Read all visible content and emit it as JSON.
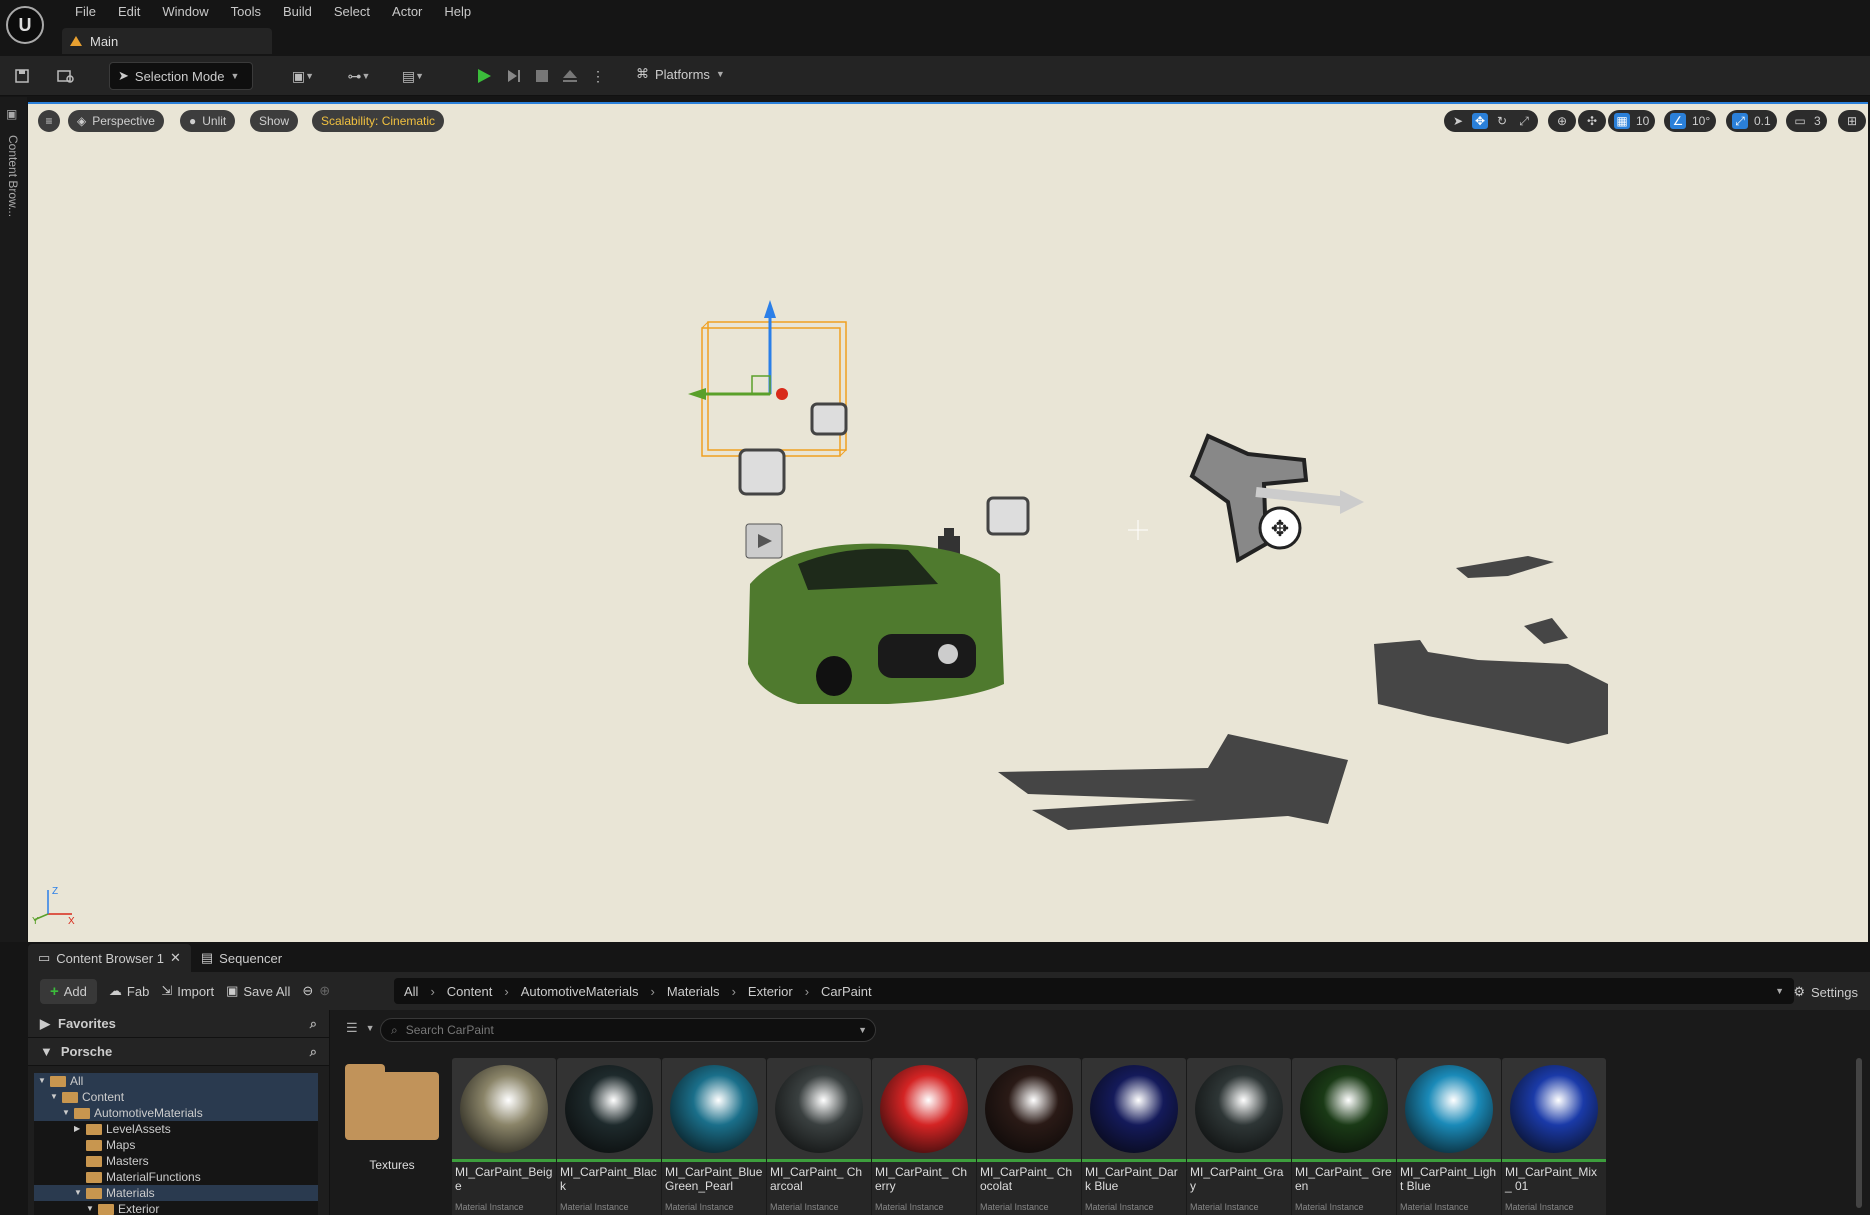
{
  "menubar": {
    "logo": "U",
    "items": [
      "File",
      "Edit",
      "Window",
      "Tools",
      "Build",
      "Select",
      "Actor",
      "Help"
    ],
    "level_tab": "Main"
  },
  "toolbar": {
    "selection_mode": "Selection Mode",
    "platforms": "Platforms"
  },
  "left_strip": {
    "label": "Content Brow..."
  },
  "viewport": {
    "menu_icon": "hamburger-icon",
    "perspective": "Perspective",
    "unlit": "Unlit",
    "show": "Show",
    "scalability": "Scalability: Cinematic",
    "grid_snap": "10",
    "rotation_snap": "10°",
    "scale_snap": "0.1",
    "camera_speed": "3",
    "axis": {
      "z": "Z",
      "x": "X",
      "y": "Y"
    }
  },
  "bottom_tabs": {
    "content_browser": "Content Browser 1",
    "sequencer": "Sequencer"
  },
  "content_browser": {
    "add": "Add",
    "fab": "Fab",
    "import": "Import",
    "save_all": "Save All",
    "breadcrumb": [
      "All",
      "Content",
      "AutomotiveMaterials",
      "Materials",
      "Exterior",
      "CarPaint"
    ],
    "settings": "Settings",
    "search_placeholder": "Search CarPaint",
    "favorites": "Favorites",
    "project": "Porsche",
    "tree": [
      {
        "label": "All",
        "depth": 0,
        "selected": true
      },
      {
        "label": "Content",
        "depth": 1,
        "selected": true
      },
      {
        "label": "AutomotiveMaterials",
        "depth": 2,
        "selected": true
      },
      {
        "label": "LevelAssets",
        "depth": 3,
        "selected": false
      },
      {
        "label": "Maps",
        "depth": 3,
        "selected": false
      },
      {
        "label": "Masters",
        "depth": 3,
        "selected": false
      },
      {
        "label": "MaterialFunctions",
        "depth": 3,
        "selected": false
      },
      {
        "label": "Materials",
        "depth": 3,
        "selected": true
      },
      {
        "label": "Exterior",
        "depth": 4,
        "selected": false
      }
    ],
    "folder": "Textures",
    "asset_type": "Material Instance",
    "assets": [
      {
        "name": "MI_CarPaint_Beige",
        "color": "#8a8468"
      },
      {
        "name": "MI_CarPaint_Black",
        "color": "#1e2a2c"
      },
      {
        "name": "MI_CarPaint_Blue Green_Pearl",
        "color": "#1a6f8a"
      },
      {
        "name": "MI_CarPaint_ Charcoal",
        "color": "#3a4040"
      },
      {
        "name": "MI_CarPaint_ Cherry",
        "color": "#d42424"
      },
      {
        "name": "MI_CarPaint_ Chocolat",
        "color": "#2a1a16"
      },
      {
        "name": "MI_CarPaint_Dark Blue",
        "color": "#141a5a"
      },
      {
        "name": "MI_CarPaint_Gray",
        "color": "#2e3636"
      },
      {
        "name": "MI_CarPaint_ Green",
        "color": "#1a3a16"
      },
      {
        "name": "MI_CarPaint_Light Blue",
        "color": "#1a8ab8"
      },
      {
        "name": "MI_CarPaint_Mix_ 01",
        "color": "#1a3aa8"
      }
    ]
  }
}
